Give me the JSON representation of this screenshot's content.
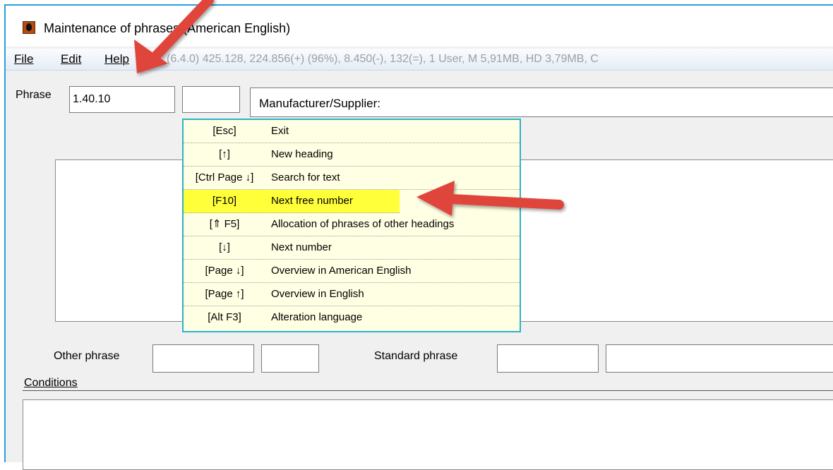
{
  "window": {
    "title": "Maintenance of phrases (American English)"
  },
  "menu": {
    "file": "File",
    "edit": "Edit",
    "help": "Help",
    "status": "(6.4.0) 425.128, 224.856(+) (96%), 8.450(-), 132(=), 1 User, M 5,91MB, HD 3,79MB, C"
  },
  "form": {
    "phrase_label": "Phrase",
    "phrase_value": "1.40.10",
    "phrase_suffix_value": "",
    "description": "Manufacturer/Supplier:",
    "other_phrase_label": "Other phrase",
    "other_phrase_value": "",
    "other_phrase_suffix": "",
    "standard_phrase_label": "Standard phrase",
    "standard_phrase_value": "",
    "standard_phrase_text": "",
    "conditions_label": "Conditions"
  },
  "popup": {
    "items": [
      {
        "key": "[Esc]",
        "action": "Exit"
      },
      {
        "key": "[↑]",
        "action": "New heading"
      },
      {
        "key": "[Ctrl Page ↓]",
        "action": "Search for text"
      },
      {
        "key": "[F10]",
        "action": "Next free number"
      },
      {
        "key": "[⇑ F5]",
        "action": "Allocation of phrases of other headings"
      },
      {
        "key": "[↓]",
        "action": "Next number"
      },
      {
        "key": "[Page ↓]",
        "action": "Overview in American English"
      },
      {
        "key": "[Page ↑]",
        "action": "Overview in English"
      },
      {
        "key": "[Alt F3]",
        "action": "Alteration language"
      }
    ],
    "highlight_color": "#ffff3a"
  },
  "annotations": {
    "arrow_color": "#e0453a"
  }
}
